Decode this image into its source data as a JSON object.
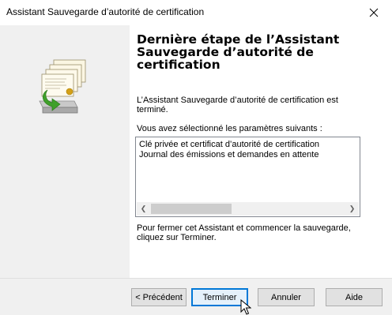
{
  "window": {
    "title": "Assistant Sauvegarde d’autorité de certification"
  },
  "content": {
    "heading_lines": [
      "Dernière étape de l’Assistant",
      "Sauvegarde d’autorité de",
      "certification"
    ],
    "completed_lines": [
      "L’Assistant Sauvegarde d’autorité de certification est",
      "terminé."
    ],
    "selected_label": "Vous avez sélectionné les paramètres suivants :",
    "selected_items": [
      "Clé privée et certificat d’autorité de certification",
      "Journal des émissions et demandes en attente"
    ],
    "instruction_lines": [
      "Pour fermer cet Assistant et commencer la sauvegarde,",
      "cliquez sur Terminer."
    ]
  },
  "buttons": {
    "back": "< Précédent",
    "finish": "Terminer",
    "cancel": "Annuler",
    "help": "Aide"
  },
  "icons": {
    "close": "close-icon",
    "wizard": "certificate-backup-icon",
    "scroll_left": "scroll-left-arrow-icon",
    "scroll_right": "scroll-right-arrow-icon",
    "cursor": "mouse-pointer-icon"
  },
  "colors": {
    "side_panel": "#f0f0f0",
    "default_button_border": "#0078d7",
    "backup_arrow": "#3fa02a"
  }
}
